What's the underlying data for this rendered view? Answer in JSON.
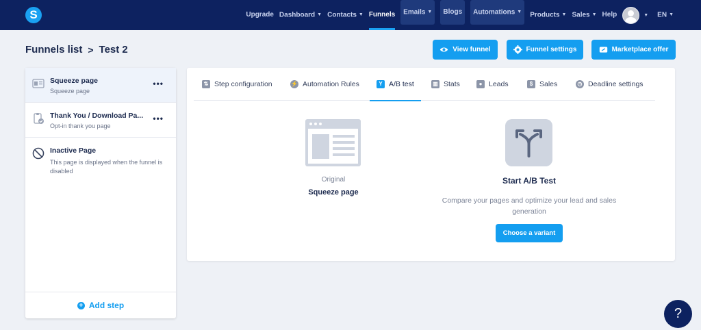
{
  "nav": {
    "logo_letter": "S",
    "items": [
      {
        "label": "Upgrade",
        "dropdown": false
      },
      {
        "label": "Dashboard",
        "dropdown": true
      },
      {
        "label": "Contacts",
        "dropdown": true
      },
      {
        "label": "Funnels",
        "dropdown": false
      },
      {
        "label": "Emails",
        "dropdown": true
      },
      {
        "label": "Blogs",
        "dropdown": false
      },
      {
        "label": "Automations",
        "dropdown": true
      },
      {
        "label": "Products",
        "dropdown": true
      },
      {
        "label": "Sales",
        "dropdown": true
      },
      {
        "label": "Help",
        "dropdown": false
      }
    ],
    "caret": "⌄",
    "language": "EN"
  },
  "header": {
    "breadcrumb_parent": "Funnels list",
    "separator": ">",
    "current": "Test 2",
    "buttons": {
      "view_funnel": "View funnel",
      "funnel_settings": "Funnel settings",
      "marketplace_offer": "Marketplace offer"
    }
  },
  "sidebar": {
    "steps": [
      {
        "title": "Squeeze page",
        "subtitle": "Squeeze page",
        "more": "•••"
      },
      {
        "title": "Thank You / Download Pa...",
        "subtitle": "Opt-in thank you page",
        "more": "•••"
      },
      {
        "title": "Inactive Page",
        "subtitle": "This page is displayed when the funnel is disabled"
      }
    ],
    "add_step": "Add step"
  },
  "tabs": [
    {
      "label": "Step configuration"
    },
    {
      "label": "Automation Rules"
    },
    {
      "label": "A/B test"
    },
    {
      "label": "Stats"
    },
    {
      "label": "Leads"
    },
    {
      "label": "Sales"
    },
    {
      "label": "Deadline settings"
    }
  ],
  "ab_test": {
    "original_label": "Original",
    "original_name": "Squeeze page",
    "start_title": "Start A/B Test",
    "description": "Compare your pages and optimize your lead and sales generation",
    "choose_variant": "Choose a variant"
  },
  "help_label": "?",
  "colors": {
    "nav_bg": "#0d2260",
    "accent": "#149ef0",
    "page_bg": "#eef1f6"
  }
}
